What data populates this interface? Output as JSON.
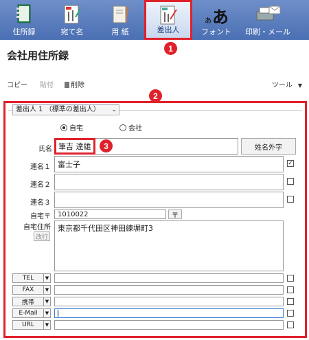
{
  "ribbon": {
    "tabs": [
      {
        "label": "住所録",
        "icon": "address-book-icon"
      },
      {
        "label": "宛て名",
        "icon": "addressee-card-icon"
      },
      {
        "label": "用 紙",
        "icon": "paper-icon"
      },
      {
        "label": "差出人",
        "icon": "sender-card-icon"
      },
      {
        "label": "フォント",
        "icon": "font-icon"
      },
      {
        "label": "印刷・メール",
        "icon": "printer-mail-icon"
      }
    ],
    "font_glyph_small": "ぁ",
    "font_glyph_large": "あ",
    "active_tab": "差出人"
  },
  "badges": [
    "1",
    "2",
    "3"
  ],
  "page_title": "会社用住所録",
  "toolbar": {
    "copy": "コピー",
    "paste": "貼付",
    "delete": "削除",
    "tools": "ツール"
  },
  "sender_select": "差出人 1 （標準の差出人）",
  "address_type": {
    "home": "自宅",
    "company": "会社",
    "selected": "自宅"
  },
  "form": {
    "name_label": "氏名",
    "name_value": "筆吉 達雄",
    "external_char_button": "姓名外字",
    "joint_names": [
      {
        "label": "連名１",
        "value": "富士子",
        "checked": true
      },
      {
        "label": "連名２",
        "value": "",
        "checked": false
      },
      {
        "label": "連名３",
        "value": "",
        "checked": false
      }
    ],
    "zip_label": "自宅〒",
    "zip_value": "1010022",
    "zip_button": "〒",
    "address_label": "自宅住所",
    "address_value": "東京都千代田区神田練塀町3",
    "newline_button": "改行",
    "contacts": [
      {
        "type": "TEL",
        "value": ""
      },
      {
        "type": "FAX",
        "value": ""
      },
      {
        "type": "携帯",
        "value": ""
      },
      {
        "type": "E-Mail",
        "value": ""
      },
      {
        "type": "URL",
        "value": ""
      }
    ]
  },
  "colors": {
    "highlight": "#e0212b",
    "ribbon": "#4a6fb3"
  }
}
